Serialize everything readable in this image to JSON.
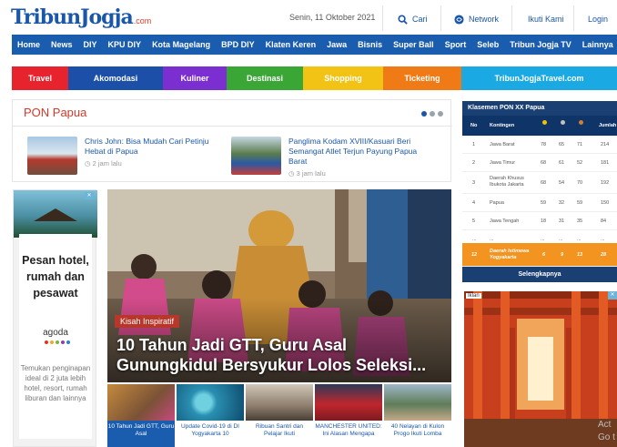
{
  "header": {
    "logo_main": "TribunJogja",
    "logo_suffix": ".com",
    "date": "Senin, 11 Oktober 2021",
    "search_label": "Cari",
    "network_label": "Network",
    "follow_label": "Ikuti Kami",
    "login_label": "Login"
  },
  "nav": [
    "Home",
    "News",
    "DIY",
    "KPU DIY",
    "Kota Magelang",
    "BPD DIY",
    "Klaten Keren",
    "Jawa",
    "Bisnis",
    "Super Ball",
    "Sport",
    "Seleb",
    "Tribun Jogja TV",
    "Lainnya"
  ],
  "categories": [
    {
      "label": "Travel",
      "color": "#e7242d"
    },
    {
      "label": "Akomodasi",
      "color": "#1b4fa8"
    },
    {
      "label": "Kuliner",
      "color": "#7b2fd1"
    },
    {
      "label": "Destinasi",
      "color": "#3aa636"
    },
    {
      "label": "Shopping",
      "color": "#f2c315"
    },
    {
      "label": "Ticketing",
      "color": "#f07a16"
    },
    {
      "label": "TribunJogjaTravel.com",
      "color": "#1aa9e3"
    }
  ],
  "pon": {
    "title": "PON Papua",
    "items": [
      {
        "headline": "Chris John: Bisa Mudah Cari Petinju Hebat di Papua",
        "time": "2 jam lalu"
      },
      {
        "headline": "Panglima Kodam XVIII/Kasuari Beri Semangat Atlet Terjun Payung Papua Barat",
        "time": "3 jam lalu"
      }
    ]
  },
  "ad_left": {
    "headline": "Pesan hotel, rumah dan pesawat",
    "brand": "agoda",
    "body": "Temukan penginapan ideal di 2 juta lebih hotel, resort, rumah liburan dan lainnya"
  },
  "hero": {
    "tag": "Kisah Inspiratif",
    "title": "10 Tahun Jadi GTT, Guru Asal Gunungkidul Bersyukur Lolos Seleksi..."
  },
  "strip": [
    "10 Tahun Jadi GTT, Guru Asal",
    "Update Covid-19 di DI Yogyakarta 10",
    "Ribuan Santri dan Pelajar Ikuti",
    "MANCHESTER UNITED: Ini Alasan Mengapa",
    "40 Nelayan di Kulon Progo Ikuti Lomba"
  ],
  "standings": {
    "title": "Klasemen PON XX Papua",
    "columns": [
      "No",
      "Kontingen",
      "",
      "",
      "",
      "Jumlah"
    ],
    "rows": [
      {
        "no": "1",
        "name": "Jawa Barat",
        "g": "78",
        "s": "65",
        "b": "71",
        "total": "214"
      },
      {
        "no": "2",
        "name": "Jawa Timur",
        "g": "68",
        "s": "61",
        "b": "52",
        "total": "181"
      },
      {
        "no": "3",
        "name": "Daerah Khusus Ibukota Jakarta",
        "g": "68",
        "s": "54",
        "b": "70",
        "total": "192"
      },
      {
        "no": "4",
        "name": "Papua",
        "g": "59",
        "s": "32",
        "b": "59",
        "total": "150"
      },
      {
        "no": "5",
        "name": "Jawa Tengah",
        "g": "18",
        "s": "31",
        "b": "35",
        "total": "84"
      },
      {
        "no": "...",
        "name": "...",
        "g": "...",
        "s": "...",
        "b": "...",
        "total": "..."
      },
      {
        "no": "12",
        "name": "Daerah Istimewa Yogyakarta",
        "g": "6",
        "s": "9",
        "b": "13",
        "total": "28"
      }
    ],
    "footer": "Selengkapnya",
    "medal_colors": [
      "#f2c200",
      "#c0c0c0",
      "#cd7f32"
    ]
  },
  "ad_right": {
    "label": "Iklan"
  },
  "watermark": {
    "line1": "Act",
    "line2": "Go t"
  }
}
